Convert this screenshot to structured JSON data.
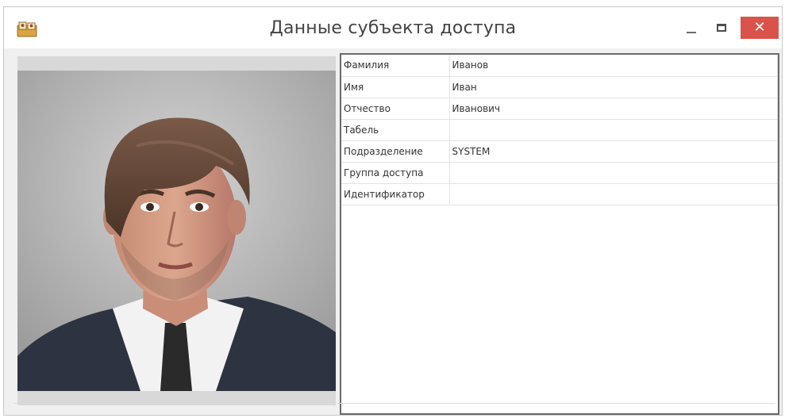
{
  "window": {
    "title": "Данные субъекта доступа",
    "close_glyph": "✕"
  },
  "icons": {
    "app": "address-card-icon",
    "minimize": "minimize-icon",
    "maximize": "maximize-icon",
    "close": "close-icon"
  },
  "colors": {
    "close_button": "#d9534b",
    "panel_border": "#6a6a6a",
    "window_bg": "#f0f0f0"
  },
  "fields": [
    {
      "label": "Фамилия",
      "value": "Иванов"
    },
    {
      "label": "Имя",
      "value": "Иван"
    },
    {
      "label": "Отчество",
      "value": "Иванович"
    },
    {
      "label": "Табель",
      "value": ""
    },
    {
      "label": "Подразделение",
      "value": "SYSTEM"
    },
    {
      "label": "Группа доступа",
      "value": ""
    },
    {
      "label": "Идентификатор",
      "value": ""
    }
  ]
}
